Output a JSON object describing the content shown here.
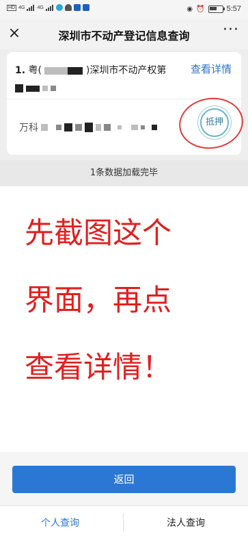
{
  "status_bar": {
    "net_labels": [
      "HD",
      "4G",
      "4G"
    ],
    "time": "5:57"
  },
  "nav": {
    "close_icon": "close-icon",
    "title": "深圳市不动产登记信息查询",
    "more_icon": "more-icon"
  },
  "record": {
    "index": "1.",
    "prefix": "粤(",
    "suffix": ")深圳市不动产权第",
    "detail_link": "查看详情",
    "owner_prefix": "万科",
    "stamp_label": "抵押"
  },
  "load_status": "1条数据加载完毕",
  "instruction": {
    "lines": [
      "先截图这个",
      "界面，再点",
      "查看详情！"
    ],
    "color": "#e21f1f"
  },
  "footer": {
    "back_label": "返回",
    "tab_personal": "个人查询",
    "tab_legal": "法人查询"
  },
  "colors": {
    "accent": "#2b78d4",
    "annotation": "#e23b3b"
  }
}
